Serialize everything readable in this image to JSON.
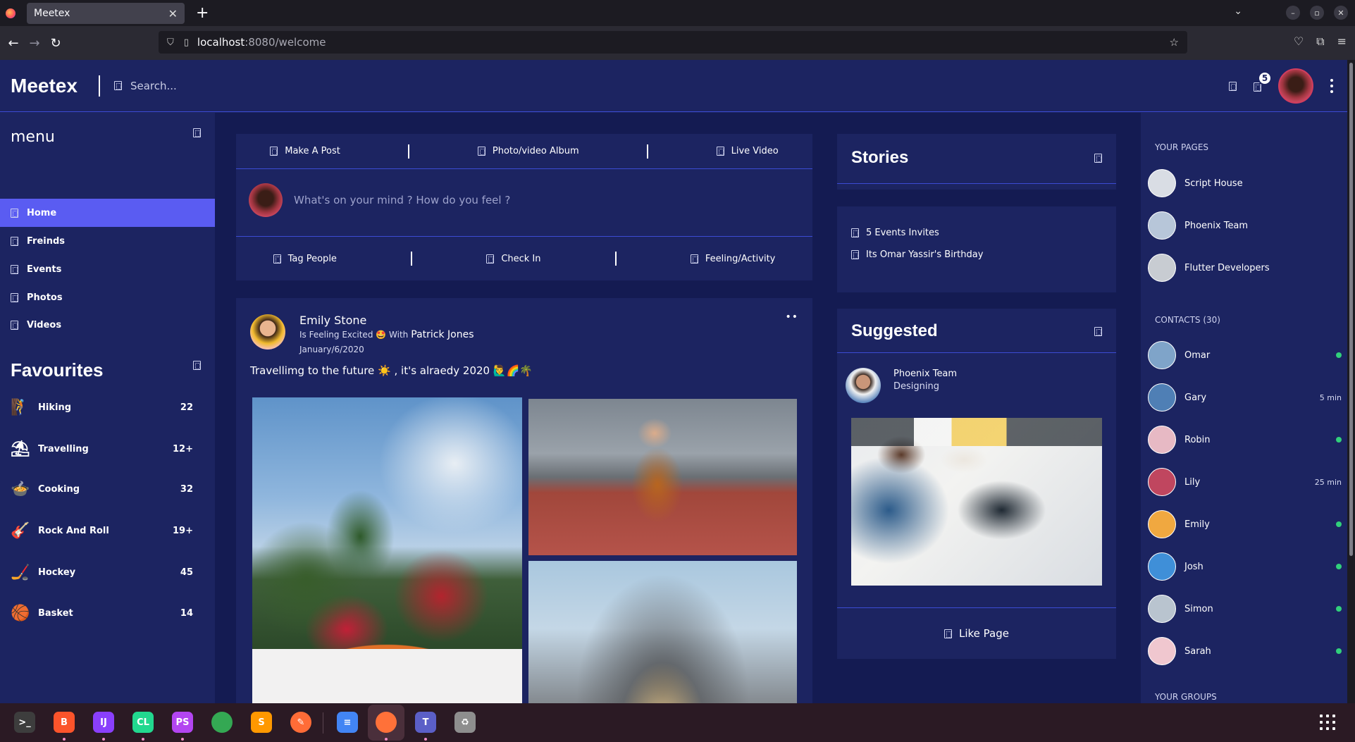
{
  "browser": {
    "tab_title": "Meetex",
    "tab_close": "✕",
    "new_tab": "+",
    "url_host": "localhost",
    "url_rest": ":8080/welcome"
  },
  "app": {
    "brand": "Meetex",
    "search_placeholder": "Search...",
    "notification_count": "5"
  },
  "left_sidebar": {
    "menu_title": "menu",
    "nav": [
      {
        "label": "Home"
      },
      {
        "label": "Freinds"
      },
      {
        "label": "Events"
      },
      {
        "label": "Photos"
      },
      {
        "label": "Videos"
      }
    ],
    "favourites_title": "Favourites",
    "favourites": [
      {
        "label": "Hiking",
        "count": "22",
        "icon": "hiking-icon",
        "emoji": "🧗"
      },
      {
        "label": "Travelling",
        "count": "12+",
        "icon": "beach-umbrella-icon",
        "emoji": "⛱"
      },
      {
        "label": "Cooking",
        "count": "32",
        "icon": "cooking-icon",
        "emoji": "🍲"
      },
      {
        "label": "Rock And Roll",
        "count": "19+",
        "icon": "guitar-icon",
        "emoji": "🎸"
      },
      {
        "label": "Hockey",
        "count": "45",
        "icon": "hockey-icon",
        "emoji": "🏒"
      },
      {
        "label": "Basket",
        "count": "14",
        "icon": "basketball-icon",
        "emoji": "🏀"
      }
    ]
  },
  "post_box": {
    "actions_top": [
      "Make A Post",
      "Photo/video Album",
      "Live Video"
    ],
    "compose_placeholder": "What's on your mind ? How do you feel ?",
    "actions_bottom": [
      "Tag People",
      "Check In",
      "Feeling/Activity"
    ]
  },
  "feed_post": {
    "author": "Emily Stone",
    "feeling": "Is Feeling Excited 🤩 With",
    "with_person": "Patrick Jones",
    "date": "January/6/2020",
    "text": "Travellimg to the future ☀️ , it's alraedy 2020 🙋‍♂️🌈🌴",
    "menu_label": "••"
  },
  "stories": {
    "title": "Stories"
  },
  "events": {
    "items": [
      "5 Events Invites",
      "Its Omar Yassir's Birthday"
    ]
  },
  "suggested": {
    "title": "Suggested",
    "page_name": "Phoenix Team",
    "page_category": "Designing",
    "like_label": "Like Page"
  },
  "right_sidebar": {
    "pages_heading": "YOUR PAGES",
    "pages": [
      {
        "name": "Script House",
        "color": "#d9dde4"
      },
      {
        "name": "Phoenix Team",
        "color": "#b7c6d9"
      },
      {
        "name": "Flutter Developers",
        "color": "#c8ccd2"
      }
    ],
    "contacts_heading": "CONTACTS (30)",
    "contacts": [
      {
        "name": "Omar",
        "status": "online",
        "last_seen": "",
        "color": "#7fa4c9"
      },
      {
        "name": "Gary",
        "status": "away",
        "last_seen": "5 min",
        "color": "#4f7fb5"
      },
      {
        "name": "Robin",
        "status": "online",
        "last_seen": "",
        "color": "#e7b9c4"
      },
      {
        "name": "Lily",
        "status": "away",
        "last_seen": "25 min",
        "color": "#c0465f"
      },
      {
        "name": "Emily",
        "status": "online",
        "last_seen": "",
        "color": "#f0a840"
      },
      {
        "name": "Josh",
        "status": "online",
        "last_seen": "",
        "color": "#3f8fd8"
      },
      {
        "name": "Simon",
        "status": "online",
        "last_seen": "",
        "color": "#b9c4cf"
      },
      {
        "name": "Sarah",
        "status": "online",
        "last_seen": "",
        "color": "#f0c7cf"
      }
    ],
    "groups_heading": "YOUR GROUPS"
  },
  "dock": {
    "apps": [
      {
        "name": "terminal-icon",
        "label": ">_",
        "color": "#3d3d3d"
      },
      {
        "name": "brave-icon",
        "label": "B",
        "color": "#fb542b"
      },
      {
        "name": "intellij-icon",
        "label": "IJ",
        "color": "#8a3ffc"
      },
      {
        "name": "clion-icon",
        "label": "CL",
        "color": "#22d88f"
      },
      {
        "name": "phpstorm-icon",
        "label": "PS",
        "color": "#b345f1"
      },
      {
        "name": "chrome-icon",
        "label": "",
        "color": "#34a853"
      },
      {
        "name": "sublime-icon",
        "label": "S",
        "color": "#ff9800"
      },
      {
        "name": "postman-icon",
        "label": "✎",
        "color": "#ff6c37"
      },
      {
        "name": "docs-icon",
        "label": "≡",
        "color": "#4285f4"
      },
      {
        "name": "firefox-icon",
        "label": "",
        "color": "#ff7139"
      },
      {
        "name": "teams-icon",
        "label": "T",
        "color": "#5b5fc7"
      },
      {
        "name": "trash-icon",
        "label": "♻",
        "color": "#8e8e8e"
      }
    ]
  },
  "colors": {
    "accent": "#5a5cf2",
    "bg": "#1c2461",
    "bg_dark": "#141b52",
    "divider": "#3c4bd4",
    "online": "#31d07b"
  }
}
